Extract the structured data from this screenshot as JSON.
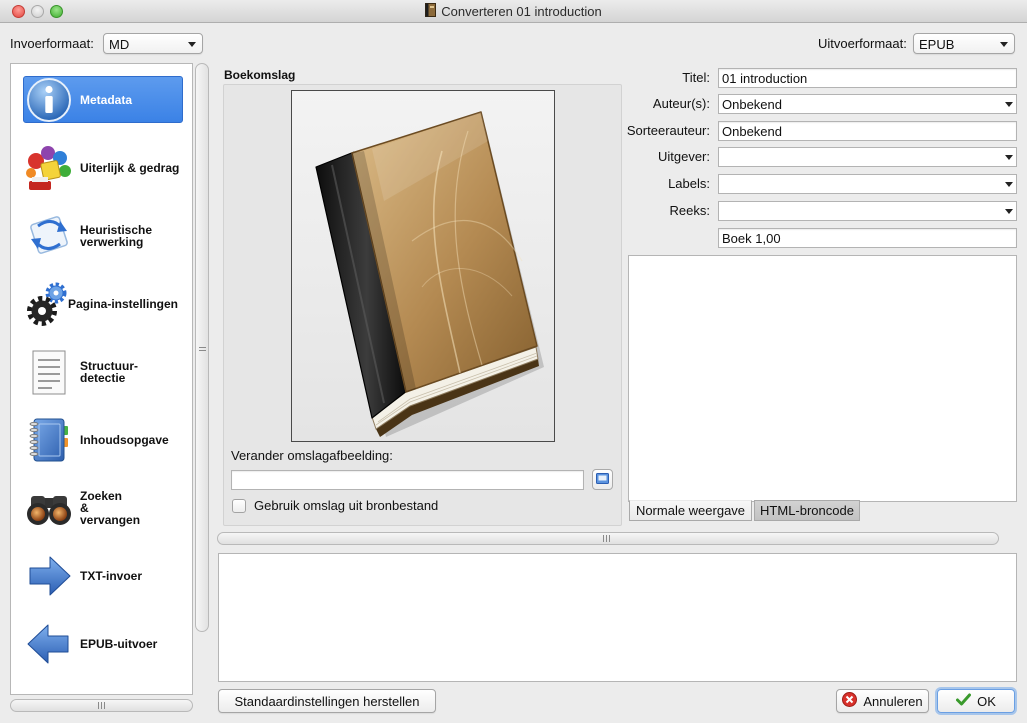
{
  "window": {
    "title": "Converteren 01 introduction",
    "icon": "book-icon"
  },
  "formats": {
    "input_label": "Invoerformaat:",
    "input_value": "MD",
    "output_label": "Uitvoerformaat:",
    "output_value": "EPUB"
  },
  "sidebar": {
    "items": [
      {
        "label": "Metadata",
        "icon": "info-icon",
        "selected": true
      },
      {
        "label": "Uiterlijk & gedrag",
        "icon": "look-and-feel-icon",
        "selected": false
      },
      {
        "label": "Heuristische verwerking",
        "icon": "heuristics-icon",
        "selected": false
      },
      {
        "label": "Pagina-instellingen",
        "icon": "gears-icon",
        "selected": false
      },
      {
        "label": "Structuur-detectie",
        "icon": "document-icon",
        "selected": false
      },
      {
        "label": "Inhoudsopgave",
        "icon": "notebook-icon",
        "selected": false
      },
      {
        "label": "Zoeken & vervangen",
        "icon": "binoculars-icon",
        "selected": false
      },
      {
        "label": "TXT-invoer",
        "icon": "arrow-right-icon",
        "selected": false
      },
      {
        "label": "EPUB-uitvoer",
        "icon": "arrow-left-icon",
        "selected": false
      }
    ]
  },
  "cover": {
    "heading": "Boekomslag",
    "image": "book-cover-icon",
    "change_label": "Verander omslagafbeelding:",
    "path_value": "",
    "browse_icon": "folder-icon",
    "use_source_label": "Gebruik omslag uit bronbestand",
    "use_source_checked": false
  },
  "metadata": {
    "title_label": "Titel:",
    "title_value": "01 introduction",
    "authors_label": "Auteur(s):",
    "authors_value": "Onbekend",
    "author_sort_label": "Sorteerauteur:",
    "author_sort_value": "Onbekend",
    "publisher_label": "Uitgever:",
    "publisher_value": "",
    "tags_label": "Labels:",
    "tags_value": "",
    "series_label": "Reeks:",
    "series_value": "",
    "series_index_value": "Boek 1,00"
  },
  "comments": {
    "tabs": [
      {
        "label": "Normale weergave",
        "active": true
      },
      {
        "label": "HTML-broncode",
        "active": false
      }
    ]
  },
  "buttons": {
    "restore_defaults": "Standaardinstellingen herstellen",
    "cancel": "Annuleren",
    "cancel_icon": "cancel-icon",
    "ok": "OK",
    "ok_icon": "checkmark-icon"
  },
  "colors": {
    "selection": "#3b82e6",
    "default_button_ring": "#6a9fe3"
  }
}
